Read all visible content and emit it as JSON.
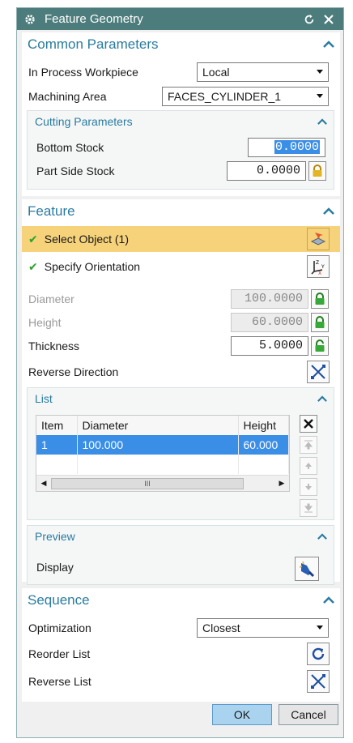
{
  "window": {
    "title": "Feature Geometry"
  },
  "common": {
    "title": "Common Parameters",
    "workpiece_label": "In Process Workpiece",
    "workpiece_value": "Local",
    "machining_label": "Machining Area",
    "machining_value": "FACES_CYLINDER_1",
    "cutting": {
      "title": "Cutting Parameters",
      "bottom_label": "Bottom Stock",
      "bottom_value": "0.0000",
      "side_label": "Part Side Stock",
      "side_value": "0.0000"
    }
  },
  "feature": {
    "title": "Feature",
    "select_object": "Select Object (1)",
    "specify_orientation": "Specify Orientation",
    "diameter_label": "Diameter",
    "diameter_value": "100.0000",
    "height_label": "Height",
    "height_value": "60.0000",
    "thickness_label": "Thickness",
    "thickness_value": "5.0000",
    "reverse_label": "Reverse Direction",
    "list": {
      "title": "List",
      "columns": [
        "Item",
        "Diameter",
        "Height"
      ],
      "rows": [
        [
          "1",
          "100.000",
          "60.000"
        ]
      ],
      "scroll_grip": "III"
    },
    "preview": {
      "title": "Preview",
      "display_label": "Display"
    }
  },
  "sequence": {
    "title": "Sequence",
    "optimization_label": "Optimization",
    "optimization_value": "Closest",
    "reorder_label": "Reorder List",
    "reverse_label": "Reverse List"
  },
  "footer": {
    "ok": "OK",
    "cancel": "Cancel"
  },
  "colors": {
    "titlebar": "#4d7c7c",
    "section_title": "#2a7ba0",
    "selection": "#3a8ee6",
    "active_row": "#f6d27a"
  }
}
